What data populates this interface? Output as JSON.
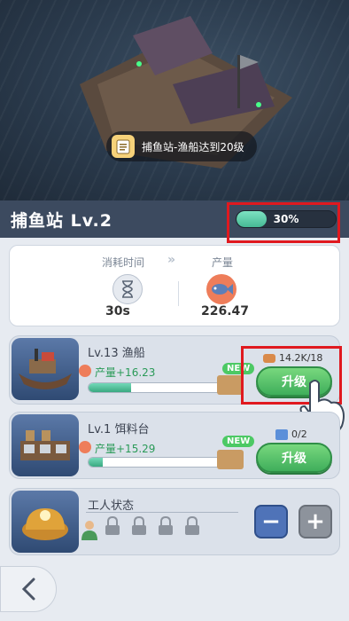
{
  "quest": {
    "text": "捕鱼站-渔船达到20级"
  },
  "header": {
    "title": "捕鱼站 Lv.2",
    "progress_pct": 30,
    "progress_label": "30%"
  },
  "stats": {
    "time_label": "消耗时间",
    "output_label": "产量",
    "time_value": "30s",
    "output_value": "226.47"
  },
  "items": [
    {
      "level": "Lv.13 渔船",
      "rate": "产量+16.23",
      "progress": 0.3,
      "new_tag": "NEW",
      "cost": "14.2K/18",
      "button": "升级"
    },
    {
      "level": "Lv.1 饵料台",
      "rate": "产量+15.29",
      "progress": 0.1,
      "new_tag": "NEW",
      "cost": "0/2",
      "button": "升级"
    }
  ],
  "workers": {
    "label": "工人状态",
    "minus": "−",
    "plus": "+"
  },
  "colors": {
    "accent_green": "#46b994",
    "highlight_red": "#e0191f",
    "header_bg": "#3c4a5f"
  }
}
